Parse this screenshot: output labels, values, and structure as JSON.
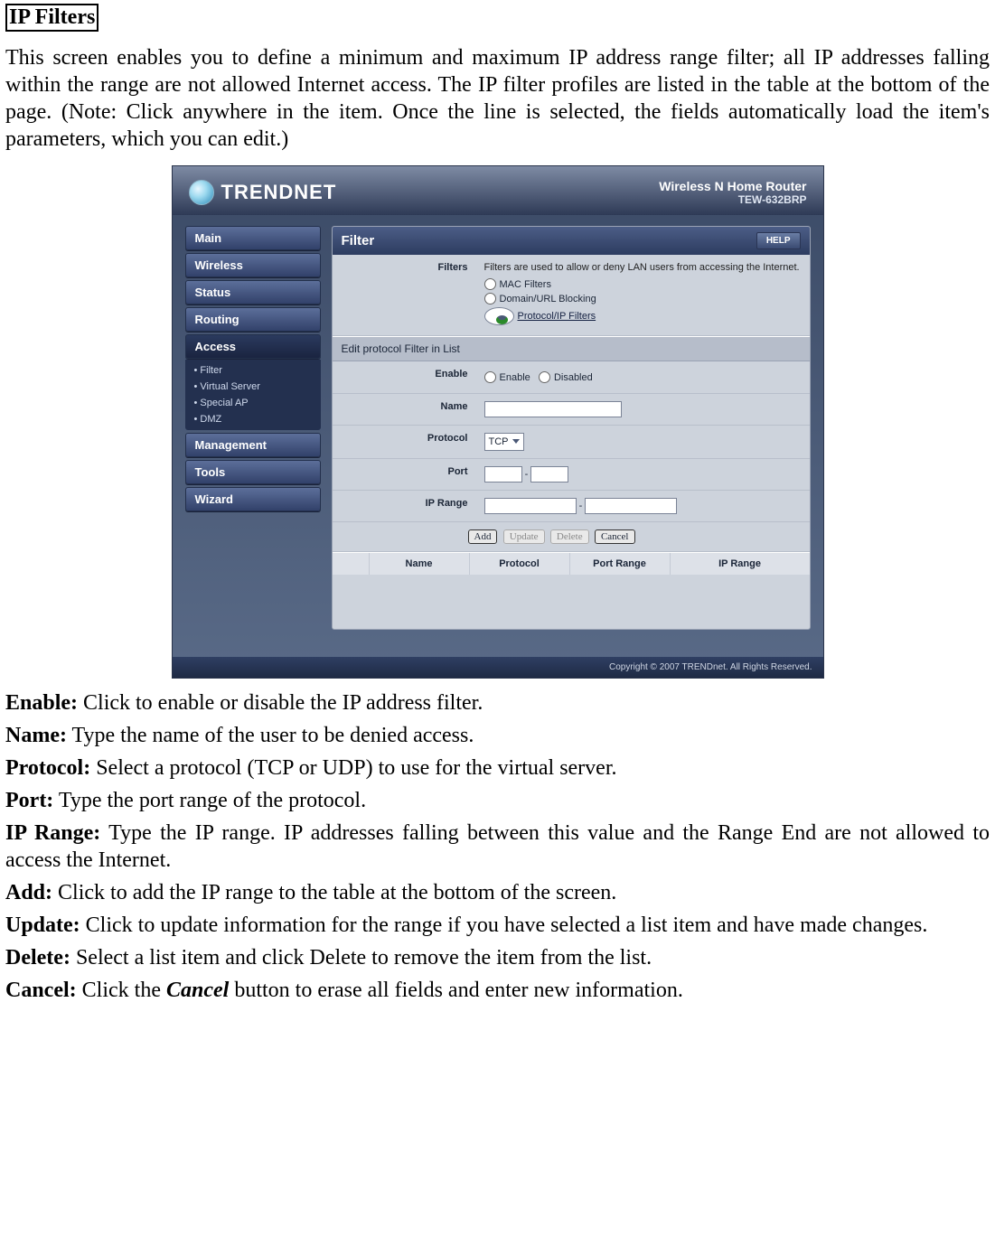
{
  "doc": {
    "heading": "IP Filters",
    "intro": "This screen enables you to define a minimum and maximum IP address range filter; all IP addresses falling within the range are not allowed Internet access. The IP filter profiles are listed in the table at the bottom of the page. (Note: Click anywhere in the item. Once the line is selected, the fields automatically load the item's parameters, which you can edit.)",
    "enable": "Click to enable or disable the IP address filter.",
    "name": "Type the name of the user to be denied access.",
    "protocol": "Select a protocol (TCP or UDP) to use for the virtual server.",
    "port": "Type the port range of the protocol.",
    "iprange": "Type the IP range. IP addresses falling between this value and the Range End are not allowed to access the Internet.",
    "add": "Click to add the IP range to the table at the bottom of the screen.",
    "update": "Click to update information for the range if you have selected a list item and have made changes.",
    "delete": "Select a list item and click Delete to remove the item from the list.",
    "cancel_pre": "Click the ",
    "cancel_em": "Cancel",
    "cancel_post": " button to erase all fields and enter new information.",
    "labels": {
      "enable_l": "Enable:",
      "name_l": "Name:",
      "protocol_l": "Protocol:",
      "port_l": "Port:",
      "iprange_l": "IP Range:",
      "add_l": "Add:",
      "update_l": "Update:",
      "delete_l": "Delete:",
      "cancel_l": "Cancel:"
    }
  },
  "ui": {
    "brand": "TRENDNET",
    "product_line1": "Wireless N Home Router",
    "product_line2": "TEW-632BRP",
    "nav": {
      "main": "Main",
      "wireless": "Wireless",
      "status": "Status",
      "routing": "Routing",
      "access": "Access",
      "sub": {
        "filter": "Filter",
        "vs": "Virtual Server",
        "sap": "Special AP",
        "dmz": "DMZ"
      },
      "management": "Management",
      "tools": "Tools",
      "wizard": "Wizard"
    },
    "panel": {
      "title": "Filter",
      "help": "HELP",
      "filters_label": "Filters",
      "filters_note": "Filters are used to allow or deny LAN users from accessing the Internet.",
      "opt_mac": "MAC Filters",
      "opt_domain": "Domain/URL Blocking",
      "opt_proto": "Protocol/IP Filters",
      "section": "Edit protocol Filter in List",
      "enable": "Enable",
      "enable_opt1": "Enable",
      "enable_opt2": "Disabled",
      "name": "Name",
      "protocol": "Protocol",
      "protocol_value": "TCP",
      "port": "Port",
      "iprange": "IP Range",
      "btn_add": "Add",
      "btn_update": "Update",
      "btn_delete": "Delete",
      "btn_cancel": "Cancel",
      "th_name": "Name",
      "th_proto": "Protocol",
      "th_port": "Port Range",
      "th_ip": "IP Range",
      "dash": "-"
    },
    "footer": "Copyright © 2007 TRENDnet. All Rights Reserved."
  }
}
